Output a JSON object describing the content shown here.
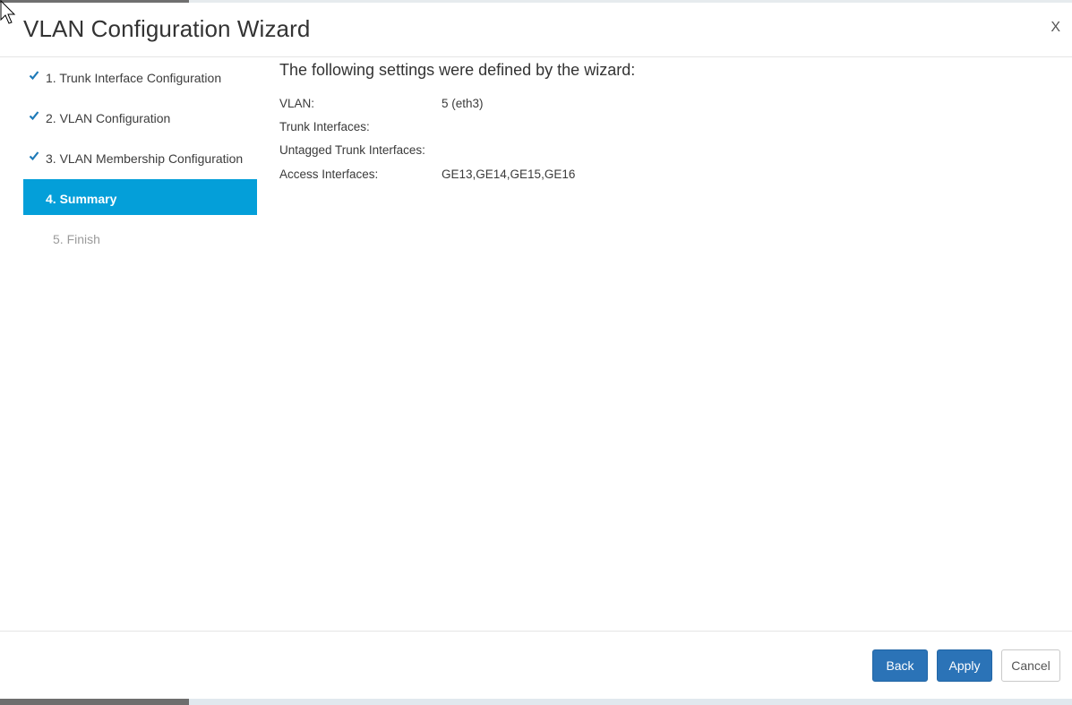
{
  "window": {
    "title": "VLAN Configuration Wizard",
    "close_label": "X"
  },
  "steps": [
    {
      "label": "1. Trunk Interface Configuration",
      "state": "done"
    },
    {
      "label": "2. VLAN Configuration",
      "state": "done"
    },
    {
      "label": "3. VLAN Membership Configuration",
      "state": "done"
    },
    {
      "label": "4. Summary",
      "state": "active"
    },
    {
      "label": "5. Finish",
      "state": "pending"
    }
  ],
  "summary": {
    "heading": "The following settings were defined by the wizard:",
    "rows": [
      {
        "key": "VLAN:",
        "value": "5 (eth3)"
      },
      {
        "key": "Trunk Interfaces:",
        "value": ""
      },
      {
        "key": "Untagged Trunk Interfaces:",
        "value": ""
      },
      {
        "key": "Access Interfaces:",
        "value": "GE13,GE14,GE15,GE16"
      }
    ]
  },
  "footer": {
    "back_label": "Back",
    "apply_label": "Apply",
    "cancel_label": "Cancel"
  },
  "colors": {
    "active_step": "#049fd9",
    "check": "#1e7ab8",
    "primary_button": "#2b73b7"
  }
}
